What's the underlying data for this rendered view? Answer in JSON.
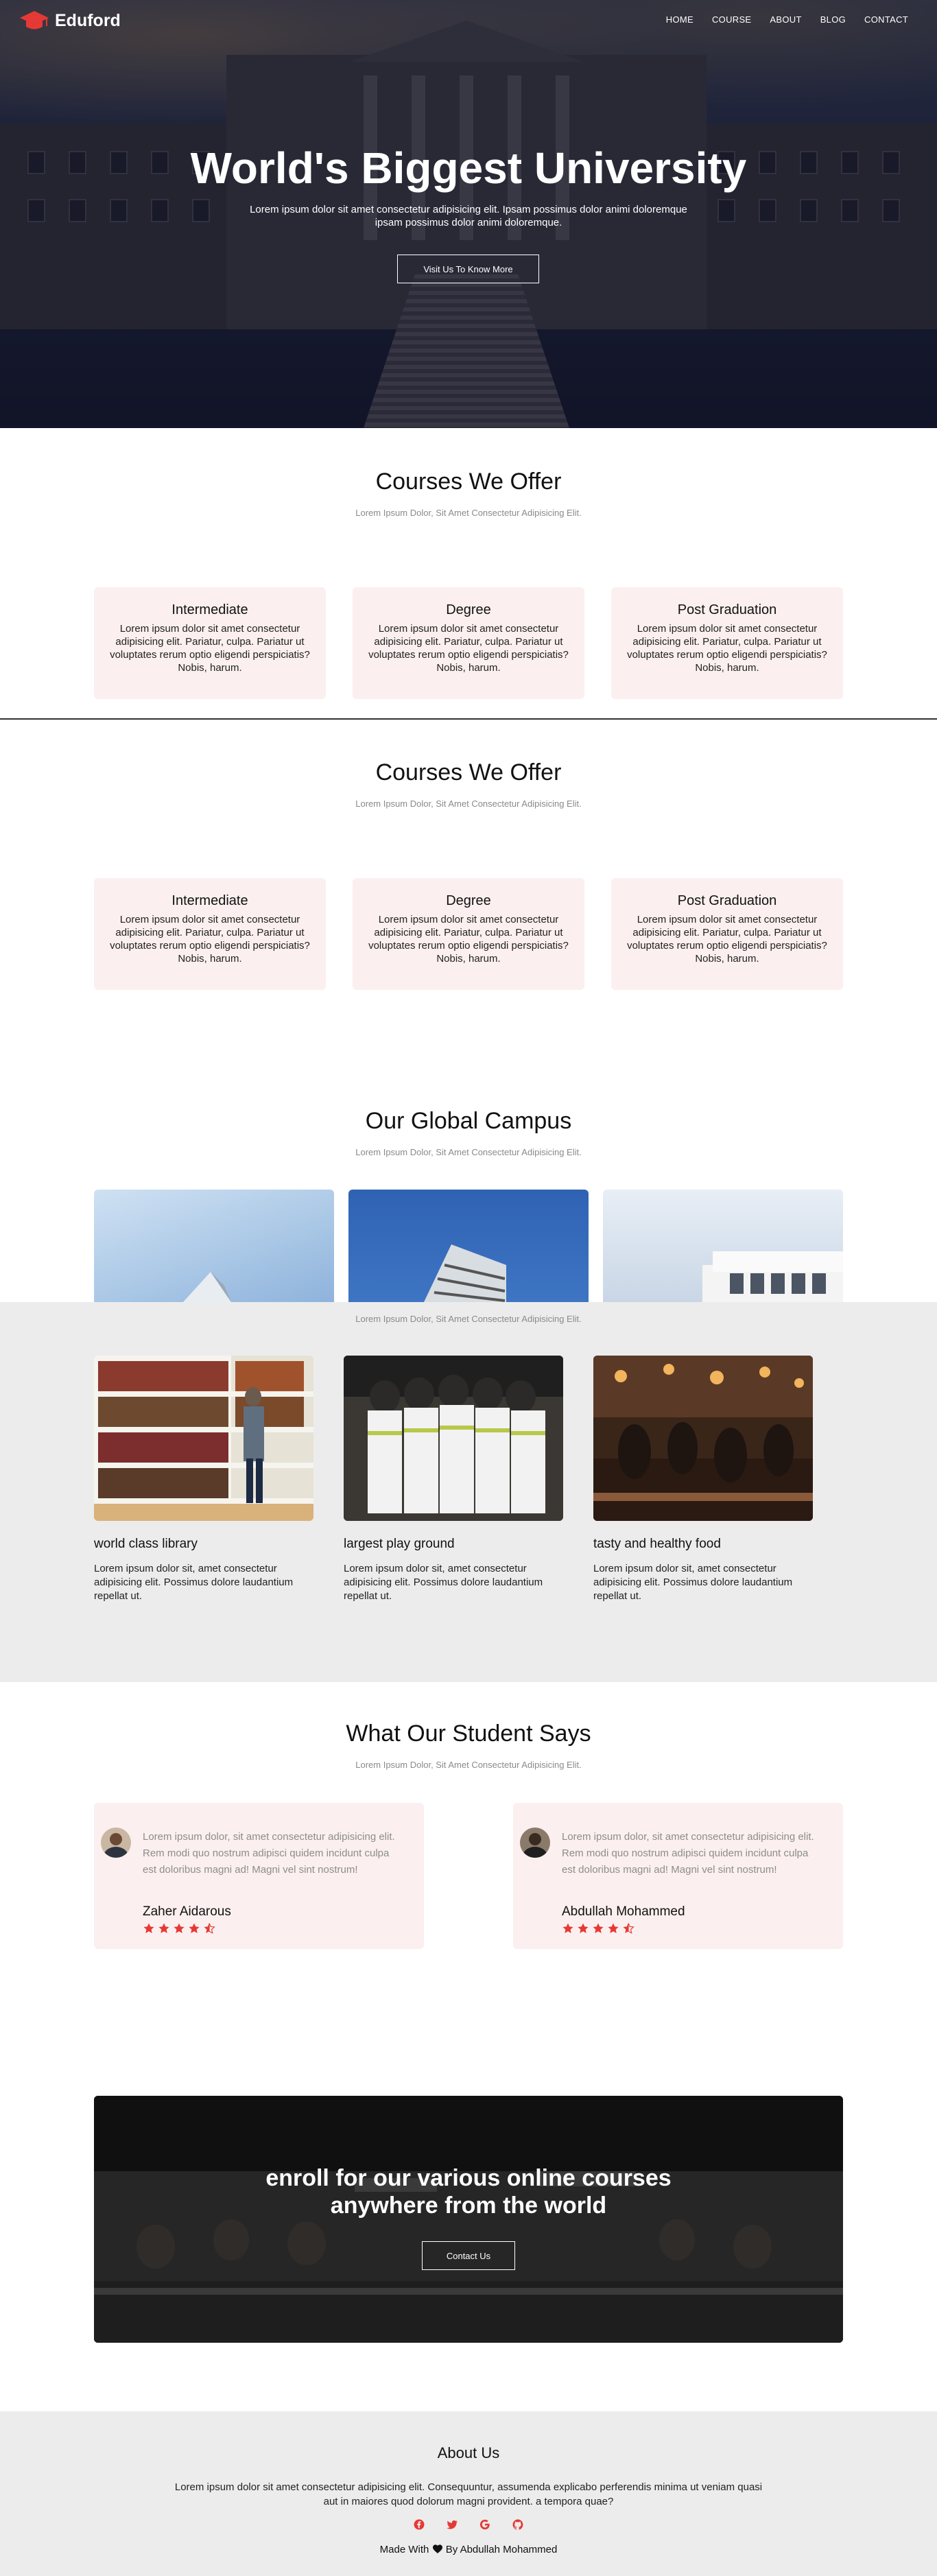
{
  "brand": {
    "name": "Eduford",
    "accent": "#e53935"
  },
  "nav": {
    "items": [
      "HOME",
      "COURSE",
      "ABOUT",
      "BLOG",
      "CONTACT"
    ]
  },
  "hero": {
    "title": "World's Biggest University",
    "subtitle_line1": "Lorem ipsum dolor sit amet consectetur adipisicing elit. Ipsam possimus dolor animi doloremque",
    "subtitle_line2": "ipsam possimus dolor animi doloremque.",
    "button": "Visit Us To Know More"
  },
  "courses_1": {
    "title": "Courses We Offer",
    "subtitle": "Lorem Ipsum Dolor, Sit Amet Consectetur Adipisicing Elit.",
    "cards": [
      {
        "title": "Intermediate",
        "text": "Lorem ipsum dolor sit amet consectetur adipisicing elit. Pariatur, culpa. Pariatur ut voluptates rerum optio eligendi perspiciatis? Nobis, harum."
      },
      {
        "title": "Degree",
        "text": "Lorem ipsum dolor sit amet consectetur adipisicing elit. Pariatur, culpa. Pariatur ut voluptates rerum optio eligendi perspiciatis? Nobis, harum."
      },
      {
        "title": "Post Graduation",
        "text": "Lorem ipsum dolor sit amet consectetur adipisicing elit. Pariatur, culpa. Pariatur ut voluptates rerum optio eligendi perspiciatis? Nobis, harum."
      }
    ]
  },
  "courses_2": {
    "title": "Courses We Offer",
    "subtitle": "Lorem Ipsum Dolor, Sit Amet Consectetur Adipisicing Elit.",
    "cards": [
      {
        "title": "Intermediate",
        "text": "Lorem ipsum dolor sit amet consectetur adipisicing elit. Pariatur, culpa. Pariatur ut voluptates rerum optio eligendi perspiciatis? Nobis, harum."
      },
      {
        "title": "Degree",
        "text": "Lorem ipsum dolor sit amet consectetur adipisicing elit. Pariatur, culpa. Pariatur ut voluptates rerum optio eligendi perspiciatis? Nobis, harum."
      },
      {
        "title": "Post Graduation",
        "text": "Lorem ipsum dolor sit amet consectetur adipisicing elit. Pariatur, culpa. Pariatur ut voluptates rerum optio eligendi perspiciatis? Nobis, harum."
      }
    ]
  },
  "campus": {
    "title": "Our Global Campus",
    "subtitle": "Lorem Ipsum Dolor, Sit Amet Consectetur Adipisicing Elit."
  },
  "facilities": {
    "subtitle": "Lorem Ipsum Dolor, Sit Amet Consectetur Adipisicing Elit.",
    "items": [
      {
        "title": "world class library",
        "text": "Lorem ipsum dolor sit, amet consectetur adipisicing elit. Possimus dolore laudantium repellat ut."
      },
      {
        "title": "largest play ground",
        "text": "Lorem ipsum dolor sit, amet consectetur adipisicing elit. Possimus dolore laudantium repellat ut."
      },
      {
        "title": "tasty and healthy food",
        "text": "Lorem ipsum dolor sit, amet consectetur adipisicing elit. Possimus dolore laudantium repellat ut."
      }
    ]
  },
  "testimonials": {
    "title": "What Our Student Says",
    "subtitle": "Lorem Ipsum Dolor, Sit Amet Consectetur Adipisicing Elit.",
    "items": [
      {
        "quote": "Lorem ipsum dolor, sit amet consectetur adipisicing elit. Rem modi quo nostrum adipisci quidem incidunt culpa est doloribus magni ad! Magni vel sint nostrum!",
        "name": "Zaher Aidarous",
        "rating": 4.5
      },
      {
        "quote": "Lorem ipsum dolor, sit amet consectetur adipisicing elit. Rem modi quo nostrum adipisci quidem incidunt culpa est doloribus magni ad! Magni vel sint nostrum!",
        "name": "Abdullah Mohammed",
        "rating": 4.5
      }
    ]
  },
  "enroll": {
    "title_line1": "enroll for our various online courses",
    "title_line2": "anywhere from the world",
    "button": "Contact Us"
  },
  "footer": {
    "title": "About Us",
    "text": "Lorem ipsum dolor sit amet consectetur adipisicing elit. Consequuntur, assumenda explicabo perferendis minima ut veniam quasi aut in maiores quod dolorum magni provident. a tempora quae?",
    "socials": [
      "facebook-icon",
      "twitter-icon",
      "google-icon",
      "github-icon"
    ],
    "credit_prefix": "Made With",
    "credit_suffix": "By Abdullah Mohammed"
  }
}
